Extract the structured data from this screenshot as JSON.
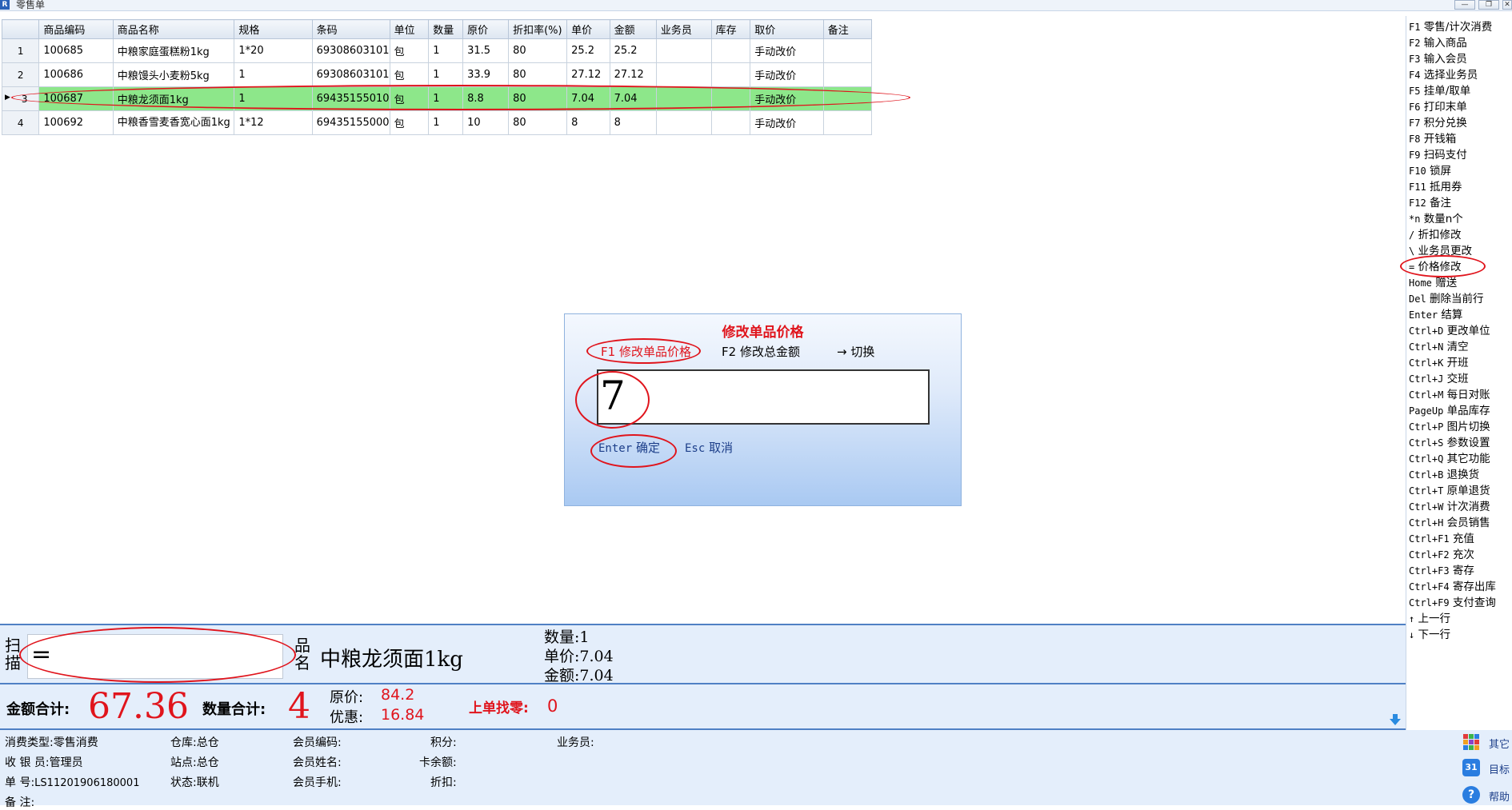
{
  "window": {
    "title": "零售单",
    "icon_text": "R",
    "controls": [
      "—",
      "❐",
      "✕"
    ]
  },
  "grid": {
    "columns": [
      "",
      "商品编码",
      "商品名称",
      "规格",
      "条码",
      "单位",
      "数量",
      "原价",
      "折扣率(%)",
      "单价",
      "金额",
      "业务员",
      "库存",
      "取价",
      "备注"
    ],
    "rows": [
      {
        "num": "1",
        "code": "100685",
        "name": "中粮家庭蛋糕粉1kg",
        "spec": "1*20",
        "barcode": "69308603101",
        "unit": "包",
        "qty": "1",
        "orig": "31.5",
        "disc": "80",
        "price": "25.2",
        "amount": "25.2",
        "clerk": "",
        "stock": "",
        "pricing": "手动改价",
        "note": ""
      },
      {
        "num": "2",
        "code": "100686",
        "name": "中粮馒头小麦粉5kg",
        "spec": "1",
        "barcode": "69308603101",
        "unit": "包",
        "qty": "1",
        "orig": "33.9",
        "disc": "80",
        "price": "27.12",
        "amount": "27.12",
        "clerk": "",
        "stock": "",
        "pricing": "手动改价",
        "note": ""
      },
      {
        "num": "3",
        "code": "100687",
        "name": "中粮龙须面1kg",
        "spec": "1",
        "barcode": "69435155010",
        "unit": "包",
        "qty": "1",
        "orig": "8.8",
        "disc": "80",
        "price": "7.04",
        "amount": "7.04",
        "clerk": "",
        "stock": "",
        "pricing": "手动改价",
        "note": ""
      },
      {
        "num": "4",
        "code": "100692",
        "name": "中粮香雪麦香宽心面1kg",
        "spec": "1*12",
        "barcode": "69435155000",
        "unit": "包",
        "qty": "1",
        "orig": "10",
        "disc": "80",
        "price": "8",
        "amount": "8",
        "clerk": "",
        "stock": "",
        "pricing": "手动改价",
        "note": ""
      }
    ],
    "selected_row_marker": "▶"
  },
  "shortcuts": [
    {
      "key": "F1",
      "label": "零售/计次消费"
    },
    {
      "key": "F2",
      "label": "输入商品"
    },
    {
      "key": "F3",
      "label": "输入会员"
    },
    {
      "key": "F4",
      "label": "选择业务员"
    },
    {
      "key": "F5",
      "label": "挂单/取单"
    },
    {
      "key": "F6",
      "label": "打印末单"
    },
    {
      "key": "F7",
      "label": "积分兑换"
    },
    {
      "key": "F8",
      "label": "开钱箱"
    },
    {
      "key": "F9",
      "label": "扫码支付"
    },
    {
      "key": "F10",
      "label": "锁屏"
    },
    {
      "key": "F11",
      "label": "抵用券"
    },
    {
      "key": "F12",
      "label": "备注"
    },
    {
      "key": "*n",
      "label": "数量n个"
    },
    {
      "key": "/",
      "label": "折扣修改"
    },
    {
      "key": "\\",
      "label": "业务员更改"
    },
    {
      "key": "=",
      "label": "价格修改"
    },
    {
      "key": "Home",
      "label": "赠送"
    },
    {
      "key": "Del",
      "label": "删除当前行"
    },
    {
      "key": "Enter",
      "label": "结算"
    },
    {
      "key": "Ctrl+D",
      "label": "更改单位"
    },
    {
      "key": "Ctrl+N",
      "label": "清空"
    },
    {
      "key": "Ctrl+K",
      "label": "开班"
    },
    {
      "key": "Ctrl+J",
      "label": "交班"
    },
    {
      "key": "Ctrl+M",
      "label": "每日对账"
    },
    {
      "key": "PageUp",
      "label": "单品库存"
    },
    {
      "key": "Ctrl+P",
      "label": "图片切换"
    },
    {
      "key": "Ctrl+S",
      "label": "参数设置"
    },
    {
      "key": "Ctrl+Q",
      "label": "其它功能"
    },
    {
      "key": "Ctrl+B",
      "label": "退换货"
    },
    {
      "key": "Ctrl+T",
      "label": "原单退货"
    },
    {
      "key": "Ctrl+W",
      "label": "计次消费"
    },
    {
      "key": "Ctrl+H",
      "label": "会员销售"
    },
    {
      "key": "Ctrl+F1",
      "label": "充值"
    },
    {
      "key": "Ctrl+F2",
      "label": "充次"
    },
    {
      "key": "Ctrl+F3",
      "label": "寄存"
    },
    {
      "key": "Ctrl+F4",
      "label": "寄存出库"
    },
    {
      "key": "Ctrl+F9",
      "label": "支付查询"
    },
    {
      "key": "↑",
      "label": "上一行"
    },
    {
      "key": "↓",
      "label": "下一行"
    }
  ],
  "dialog": {
    "title": "修改单品价格",
    "mode_f1": "F1 修改单品价格",
    "mode_f2": "F2 修改总金额",
    "switch_arrow": "→",
    "switch_label": "切换",
    "input_value": "7",
    "confirm_key": "Enter",
    "confirm_label": "确定",
    "cancel_key": "Esc",
    "cancel_label": "取消"
  },
  "scan": {
    "label": "扫描",
    "input_value": "=",
    "name_label": "品名",
    "product_name": "中粮龙须面1kg",
    "qty_label": "数量:",
    "qty_value": "1",
    "price_label": "单价:",
    "price_value": "7.04",
    "amount_label": "金额:",
    "amount_value": "7.04"
  },
  "totals": {
    "amount_label": "金额合计:",
    "amount_value": "67.36",
    "qty_label": "数量合计:",
    "qty_value": "4",
    "orig_label": "原价:",
    "orig_value": "84.2",
    "discount_label": "优惠:",
    "discount_value": "16.84",
    "change_label": "上单找零:",
    "change_value": "0"
  },
  "status": {
    "consume_type_label": "消费类型:",
    "consume_type": "零售消费",
    "cashier_label": "收 银 员:",
    "cashier": "管理员",
    "order_label": "单    号:",
    "order_no": "LS11201906180001",
    "note_label": "备    注:",
    "warehouse_label": "仓库:",
    "warehouse": "总仓",
    "station_label": "站点:",
    "station": "总仓",
    "state_label": "状态:",
    "state": "联机",
    "member_code_label": "会员编码:",
    "member_name_label": "会员姓名:",
    "member_phone_label": "会员手机:",
    "points_label": "积分:",
    "card_balance_label": "卡余额:",
    "discount_label": "折扣:",
    "clerk_label": "业务员:"
  },
  "side_buttons": [
    {
      "label": "其它",
      "icon": "grid-apps-icon"
    },
    {
      "label": "目标",
      "icon": "calendar-31-icon",
      "icon_text": "31"
    },
    {
      "label": "帮助",
      "icon": "help-icon",
      "icon_text": "?"
    }
  ],
  "colors": {
    "selected_row": "#8de78a",
    "accent_red": "#e0141c",
    "panel_blue": "#e4eefb",
    "border_blue": "#4f80c4"
  }
}
